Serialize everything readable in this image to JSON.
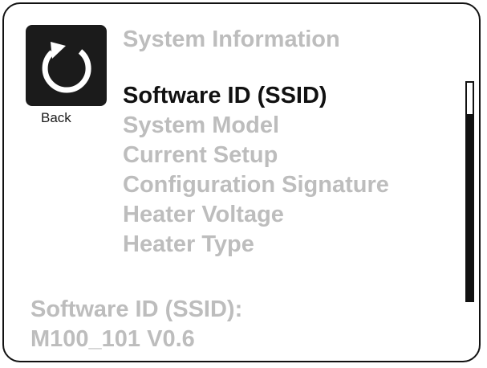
{
  "back": {
    "label": "Back",
    "icon": "refresh-back-icon"
  },
  "section_title": "System Information",
  "menu": {
    "items": [
      {
        "label": "Software ID (SSID)",
        "selected": true
      },
      {
        "label": "System Model",
        "selected": false
      },
      {
        "label": "Current Setup",
        "selected": false
      },
      {
        "label": "Configuration Signature",
        "selected": false
      },
      {
        "label": "Heater Voltage",
        "selected": false
      },
      {
        "label": "Heater Type",
        "selected": false
      }
    ]
  },
  "detail": {
    "label": "Software ID (SSID):",
    "value": "M100_101 V0.6"
  },
  "colors": {
    "selected_text": "#111111",
    "dimmed_text": "#bdbdbd",
    "button_bg": "#1b1b1b"
  }
}
